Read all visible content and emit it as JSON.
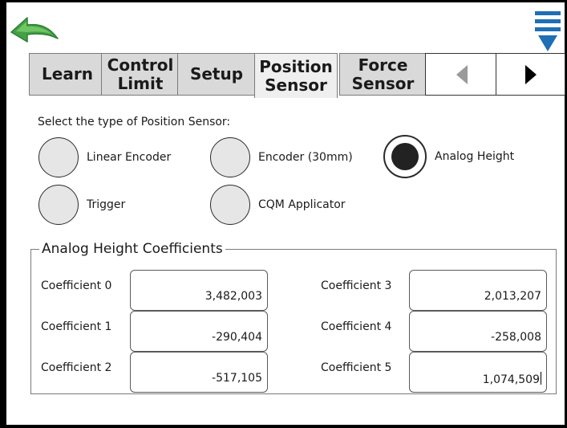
{
  "toolbar": {
    "back_icon": "back-arrow-icon",
    "menu_icon": "menu-filter-icon",
    "back_color": "#4caf50",
    "menu_color": "#1f6fb5"
  },
  "tabs": [
    {
      "lines": [
        "Learn"
      ],
      "active": false
    },
    {
      "lines": [
        "Control",
        "Limit"
      ],
      "active": false
    },
    {
      "lines": [
        "Setup"
      ],
      "active": false
    },
    {
      "lines": [
        "Position",
        "Sensor"
      ],
      "active": true
    },
    {
      "lines": [
        "Force",
        "Sensor"
      ],
      "active": false
    }
  ],
  "tab_nav": {
    "prev_icon": "triangle-left-icon",
    "next_icon": "triangle-right-icon",
    "prev_enabled": false,
    "next_enabled": true
  },
  "sensor_select": {
    "prompt": "Select the type of Position Sensor:",
    "options": [
      {
        "label": "Linear Encoder",
        "selected": false
      },
      {
        "label": "Encoder (30mm)",
        "selected": false
      },
      {
        "label": "Analog Height",
        "selected": true
      },
      {
        "label": "Trigger",
        "selected": false
      },
      {
        "label": "CQM Applicator",
        "selected": false
      }
    ]
  },
  "coefficients": {
    "title": "Analog Height Coefficients",
    "items": [
      {
        "label": "Coefficient 0",
        "value": "3,482,003"
      },
      {
        "label": "Coefficient 1",
        "value": "-290,404"
      },
      {
        "label": "Coefficient 2",
        "value": "-517,105"
      },
      {
        "label": "Coefficient 3",
        "value": "2,013,207"
      },
      {
        "label": "Coefficient 4",
        "value": "-258,008"
      },
      {
        "label": "Coefficient 5",
        "value": "1,074,509"
      }
    ]
  }
}
